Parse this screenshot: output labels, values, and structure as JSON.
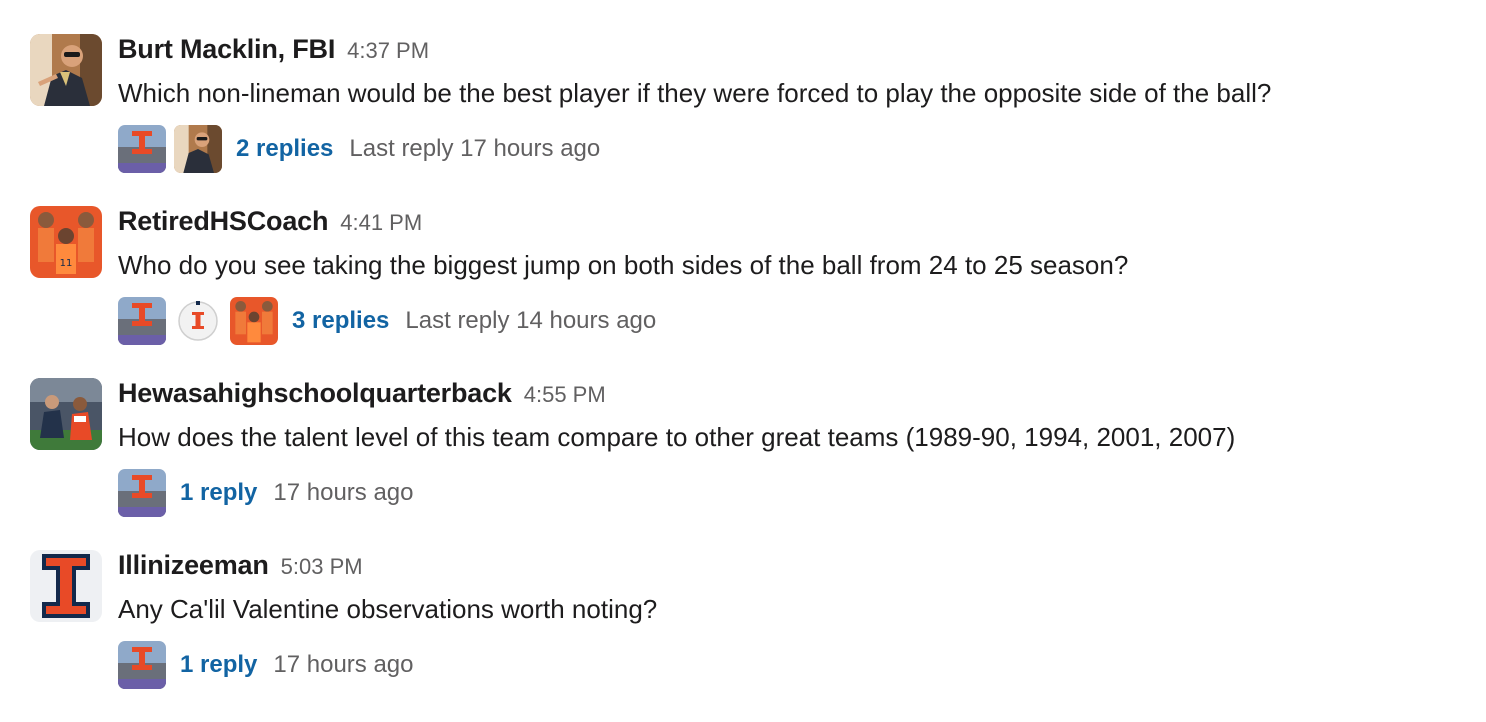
{
  "messages": [
    {
      "author": "Burt Macklin, FBI",
      "time": "4:37 PM",
      "text": "Which non-lineman would be the best player if they were forced to play the opposite side of the ball?",
      "avatar_icon": "man-pointing-photo-avatar",
      "thread": {
        "participants": [
          "stadium-photo-avatar",
          "man-pointing-photo-avatar"
        ],
        "replies": "2 replies",
        "last_reply": "Last reply 17 hours ago"
      }
    },
    {
      "author": "RetiredHSCoach",
      "time": "4:41 PM",
      "text": "Who do you see taking the biggest jump on both sides of the ball from 24 to 25 season?",
      "avatar_icon": "basketball-players-avatar",
      "thread": {
        "participants": [
          "stadium-photo-avatar",
          "golf-ball-avatar",
          "basketball-players-avatar"
        ],
        "replies": "3 replies",
        "last_reply": "Last reply 14 hours ago"
      }
    },
    {
      "author": "Hewasahighschoolquarterback",
      "time": "4:55 PM",
      "text": "How does the talent level of this team compare to other great teams (1989-90, 1994, 2001, 2007)",
      "avatar_icon": "sideline-photo-avatar",
      "thread": {
        "participants": [
          "stadium-photo-avatar"
        ],
        "replies": "1 reply",
        "last_reply": "17 hours ago"
      }
    },
    {
      "author": "Illinizeeman",
      "time": "5:03 PM",
      "text": "Any Ca'lil Valentine observations worth noting?",
      "avatar_icon": "illinois-block-i-avatar",
      "thread": {
        "participants": [
          "stadium-photo-avatar"
        ],
        "replies": "1 reply",
        "last_reply": "17 hours ago"
      }
    }
  ],
  "colors": {
    "link": "#1264a3",
    "muted": "#616061",
    "text": "#1d1c1d",
    "illini_orange": "#e84a27",
    "illini_blue": "#13294b"
  }
}
